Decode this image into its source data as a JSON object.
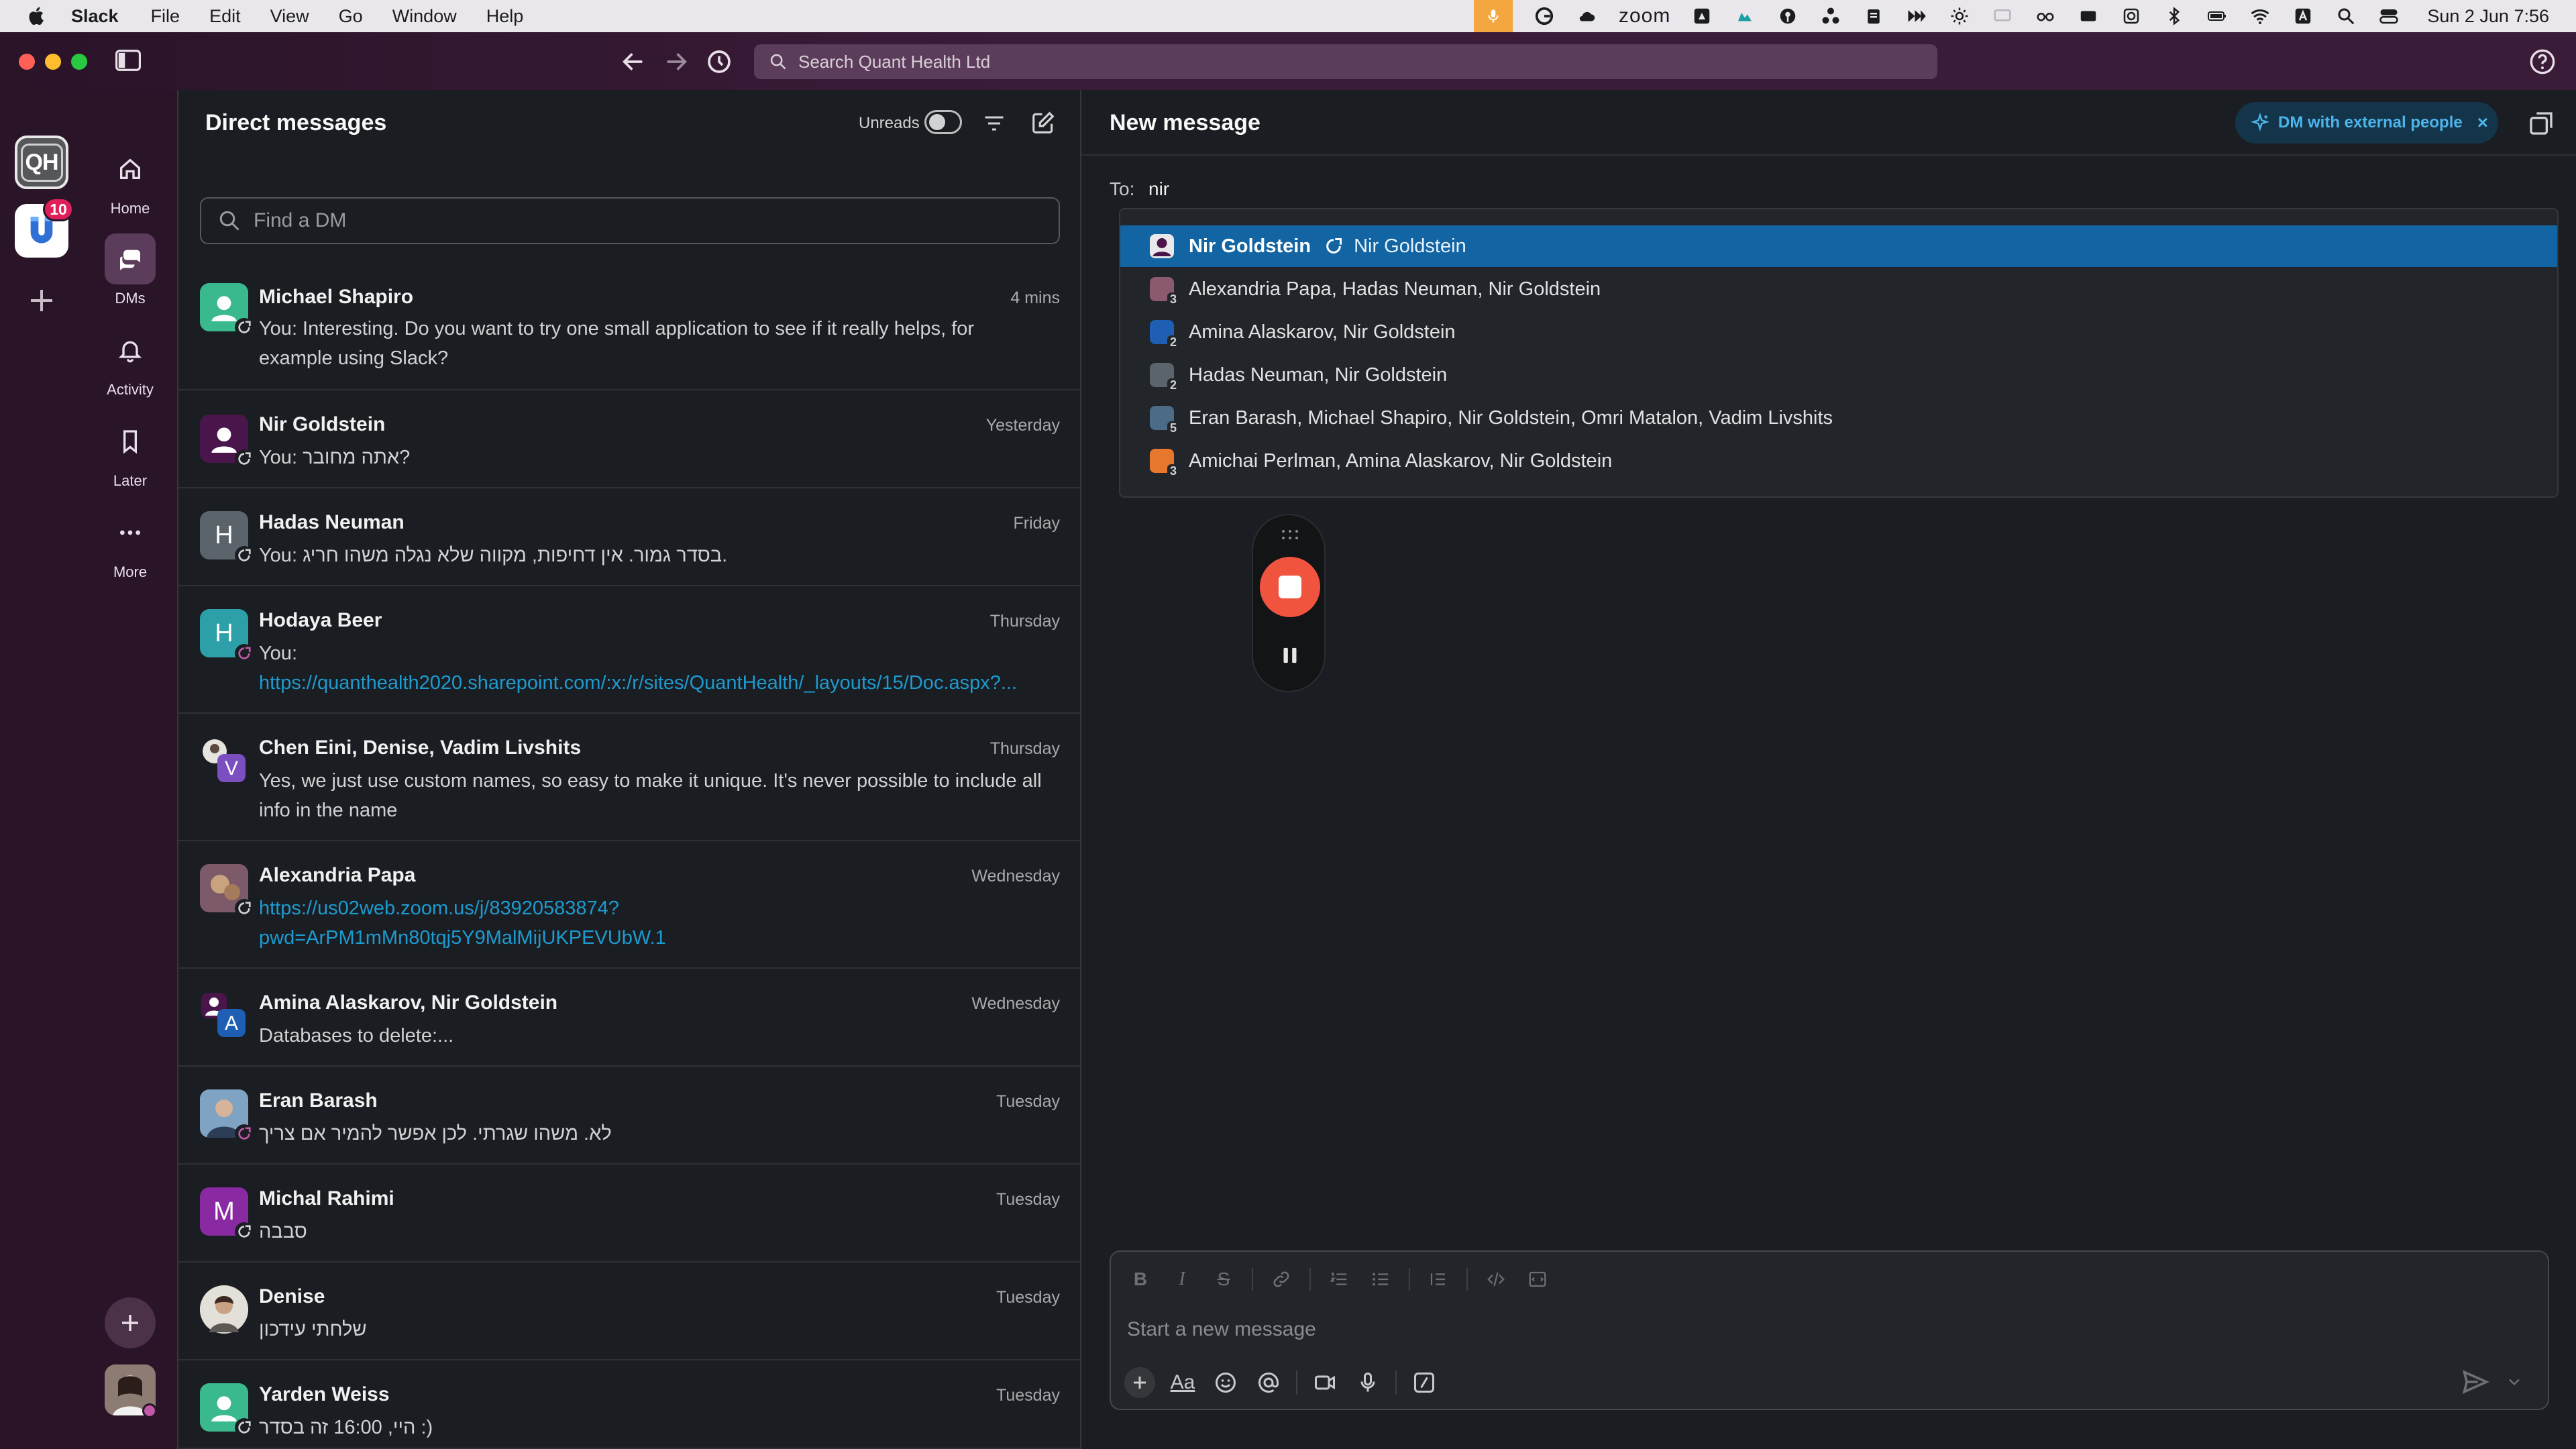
{
  "menubar": {
    "app_name": "Slack",
    "menus": [
      "File",
      "Edit",
      "View",
      "Go",
      "Window",
      "Help"
    ],
    "zoom_label": "zoom",
    "clock": "Sun 2 Jun  7:56"
  },
  "titlebar": {
    "search_placeholder": "Search Quant Health Ltd"
  },
  "rail": {
    "workspace_initials": "QH",
    "badge_count": "10"
  },
  "nav": {
    "items": [
      {
        "label": "Home"
      },
      {
        "label": "DMs"
      },
      {
        "label": "Activity"
      },
      {
        "label": "Later"
      },
      {
        "label": "More"
      }
    ]
  },
  "dm_panel": {
    "title": "Direct messages",
    "unreads_label": "Unreads",
    "find_placeholder": "Find a DM",
    "rows": [
      {
        "name": "Michael Shapiro",
        "time": "4 mins",
        "line1": "You: Interesting. Do you want to try one small application to see if it really helps, for",
        "line2": "example using Slack?"
      },
      {
        "name": "Nir Goldstein",
        "time": "Yesterday",
        "line1": "You: אתה מחובר?"
      },
      {
        "name": "Hadas Neuman",
        "time": "Friday",
        "initial": "H",
        "line1": "You: בסדר גמור. אין דחיפות, מקווה שלא נגלה משהו חריג."
      },
      {
        "name": "Hodaya Beer",
        "time": "Thursday",
        "initial": "H",
        "line1": "You:",
        "link": "https://quanthealth2020.sharepoint.com/:x:/r/sites/QuantHealth/_layouts/15/Doc.aspx?..."
      },
      {
        "name": "Chen Eini, Denise, Vadim Livshits",
        "time": "Thursday",
        "initial": "V",
        "line1": "Yes, we just use custom names, so easy to make it unique. It's never possible to include all",
        "line2": "info in the name"
      },
      {
        "name": "Alexandria Papa",
        "time": "Wednesday",
        "link": "https://us02web.zoom.us/j/83920583874?",
        "link2": "pwd=ArPM1mMn80tqj5Y9MalMijUKPEVUbW.1"
      },
      {
        "name": "Amina Alaskarov, Nir Goldstein",
        "time": "Wednesday",
        "initial": "A",
        "line1": "Databases to delete:..."
      },
      {
        "name": "Eran Barash",
        "time": "Tuesday",
        "line1": "לא. משהו שגרתי. לכן אפשר להמיר אם צריך"
      },
      {
        "name": "Michal Rahimi",
        "time": "Tuesday",
        "initial": "M",
        "line1": "סבבה"
      },
      {
        "name": "Denise",
        "time": "Tuesday",
        "line1": "שלחתי עידכון"
      },
      {
        "name": "Yarden Weiss",
        "time": "Tuesday",
        "line1": "היי, 16:00 זה בסדר :)"
      }
    ]
  },
  "compose": {
    "title": "New message",
    "external_chip": "DM with external people",
    "to_label": "To:",
    "to_value": "nir",
    "suggestions": [
      {
        "label": "Nir Goldstein",
        "alt": "Nir Goldstein",
        "count": ""
      },
      {
        "label": "Alexandria Papa, Hadas Neuman, Nir Goldstein",
        "count": "3"
      },
      {
        "label": "Amina Alaskarov, Nir Goldstein",
        "count": "2"
      },
      {
        "label": "Hadas Neuman, Nir Goldstein",
        "count": "2"
      },
      {
        "label": "Eran Barash, Michael Shapiro, Nir Goldstein, Omri Matalon, Vadim Livshits",
        "count": "5"
      },
      {
        "label": "Amichai Perlman, Amina Alaskarov, Nir Goldstein",
        "count": "3"
      }
    ],
    "message_placeholder": "Start a new message",
    "aa_label": "Aa"
  },
  "colors": {
    "accent": "#1264a3",
    "link": "#1d9bd1",
    "record": "#f0543f",
    "sidebar": "#2a1428",
    "external": "#4cb5ea"
  }
}
